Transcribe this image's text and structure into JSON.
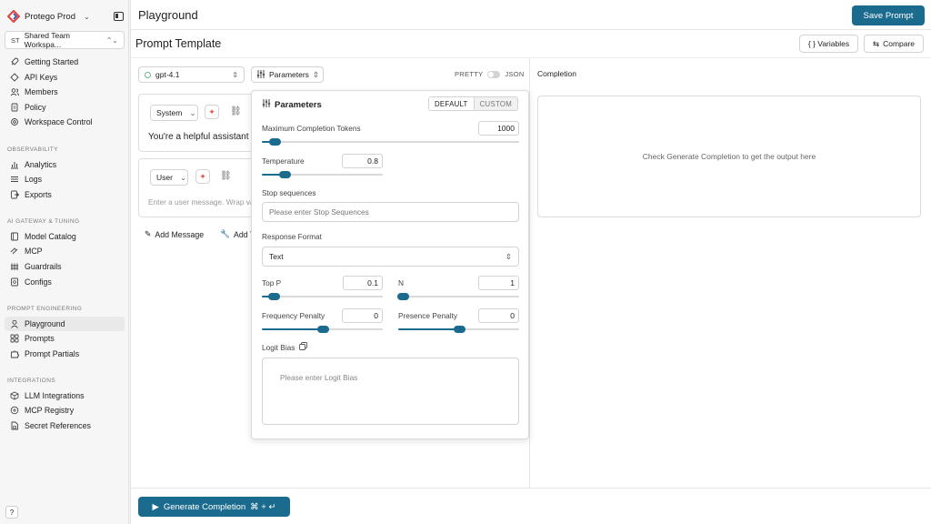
{
  "org": {
    "name": "Protego Prod"
  },
  "workspace": {
    "initials": "ST",
    "name": "Shared Team Workspa..."
  },
  "nav": {
    "top": [
      "Getting Started",
      "API Keys",
      "Members",
      "Policy",
      "Workspace Control"
    ],
    "observability": {
      "label": "OBSERVABILITY",
      "items": [
        "Analytics",
        "Logs",
        "Exports"
      ]
    },
    "gateway": {
      "label": "AI GATEWAY & TUNING",
      "items": [
        "Model Catalog",
        "MCP",
        "Guardrails",
        "Configs"
      ]
    },
    "prompt": {
      "label": "PROMPT ENGINEERING",
      "items": [
        "Playground",
        "Prompts",
        "Prompt Partials"
      ],
      "active": "Playground"
    },
    "integrations": {
      "label": "INTEGRATIONS",
      "items": [
        "LLM Integrations",
        "MCP Registry",
        "Secret References"
      ]
    }
  },
  "help": "?",
  "header": {
    "title": "Playground",
    "save_label": "Save Prompt"
  },
  "template": {
    "title": "Prompt Template",
    "variables_label": "{ } Variables",
    "compare_label": "Compare"
  },
  "toolbar": {
    "model": "gpt-4.1",
    "params_label": "Parameters",
    "pretty": "PRETTY",
    "json": "JSON"
  },
  "messages": [
    {
      "role": "System",
      "text": "You're a helpful assistant"
    },
    {
      "role": "User",
      "placeholder": "Enter a user message. Wrap variables in {{}}"
    }
  ],
  "actions": {
    "add_message": "Add Message",
    "add_tool": "Add Tool"
  },
  "params": {
    "title": "Parameters",
    "mode_default": "DEFAULT",
    "mode_custom": "CUSTOM",
    "max_tokens": {
      "label": "Maximum Completion Tokens",
      "value": "1000",
      "fraction": 0.05
    },
    "temperature": {
      "label": "Temperature",
      "value": "0.8",
      "fraction": 0.19
    },
    "stop": {
      "label": "Stop sequences",
      "placeholder": "Please enter Stop Sequences"
    },
    "response_format": {
      "label": "Response Format",
      "value": "Text"
    },
    "top_p": {
      "label": "Top P",
      "value": "0.1",
      "fraction": 0.1
    },
    "n": {
      "label": "N",
      "value": "1",
      "fraction": 0.04
    },
    "frequency_penalty": {
      "label": "Frequency Penalty",
      "value": "0",
      "fraction": 0.5
    },
    "presence_penalty": {
      "label": "Presence Penalty",
      "value": "0",
      "fraction": 0.5
    },
    "logit_bias": {
      "label": "Logit Bias",
      "placeholder": "Please enter Logit Bias"
    }
  },
  "completion": {
    "label": "Completion",
    "placeholder": "Check Generate Completion to get the output here"
  },
  "generate": {
    "label": "Generate Completion",
    "shortcut": "⌘ + ↵"
  },
  "colors": {
    "accent": "#1b6b8f"
  }
}
